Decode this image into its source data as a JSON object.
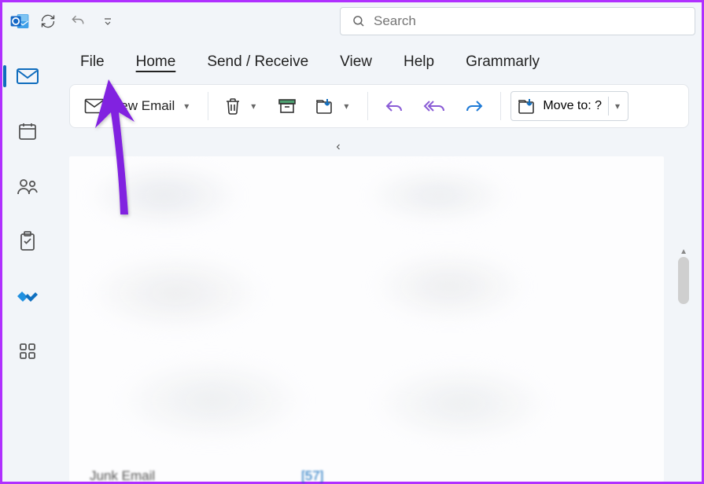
{
  "titlebar": {
    "search_placeholder": "Search"
  },
  "rail": {
    "items": [
      "mail",
      "calendar",
      "people",
      "tasks",
      "todo",
      "apps"
    ]
  },
  "tabs": {
    "file": "File",
    "home": "Home",
    "send_receive": "Send / Receive",
    "view": "View",
    "help": "Help",
    "grammarly": "Grammarly",
    "active": "home"
  },
  "ribbon": {
    "new_email": "New Email",
    "move_to": "Move to: ?"
  },
  "peek": {
    "folder": "Junk Email",
    "count": "[57]"
  }
}
